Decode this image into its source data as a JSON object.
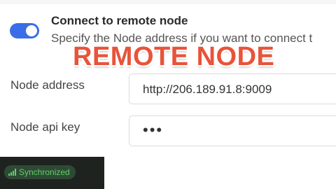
{
  "setting": {
    "title": "Connect to remote node",
    "description": "Specify the Node address if you want to connect t",
    "enabled": true
  },
  "overlay": {
    "title": "REMOTE NODE"
  },
  "fields": {
    "node_address": {
      "label": "Node address",
      "value": "http://206.189.91.8:9009"
    },
    "node_api_key": {
      "label": "Node api key",
      "value": "•••"
    }
  },
  "status": {
    "label": "Synchronized",
    "icon": "signal-bars-icon",
    "color": "#5fd06a"
  },
  "colors": {
    "toggle_on": "#3a6ee8",
    "overlay_text": "#e8543a"
  }
}
